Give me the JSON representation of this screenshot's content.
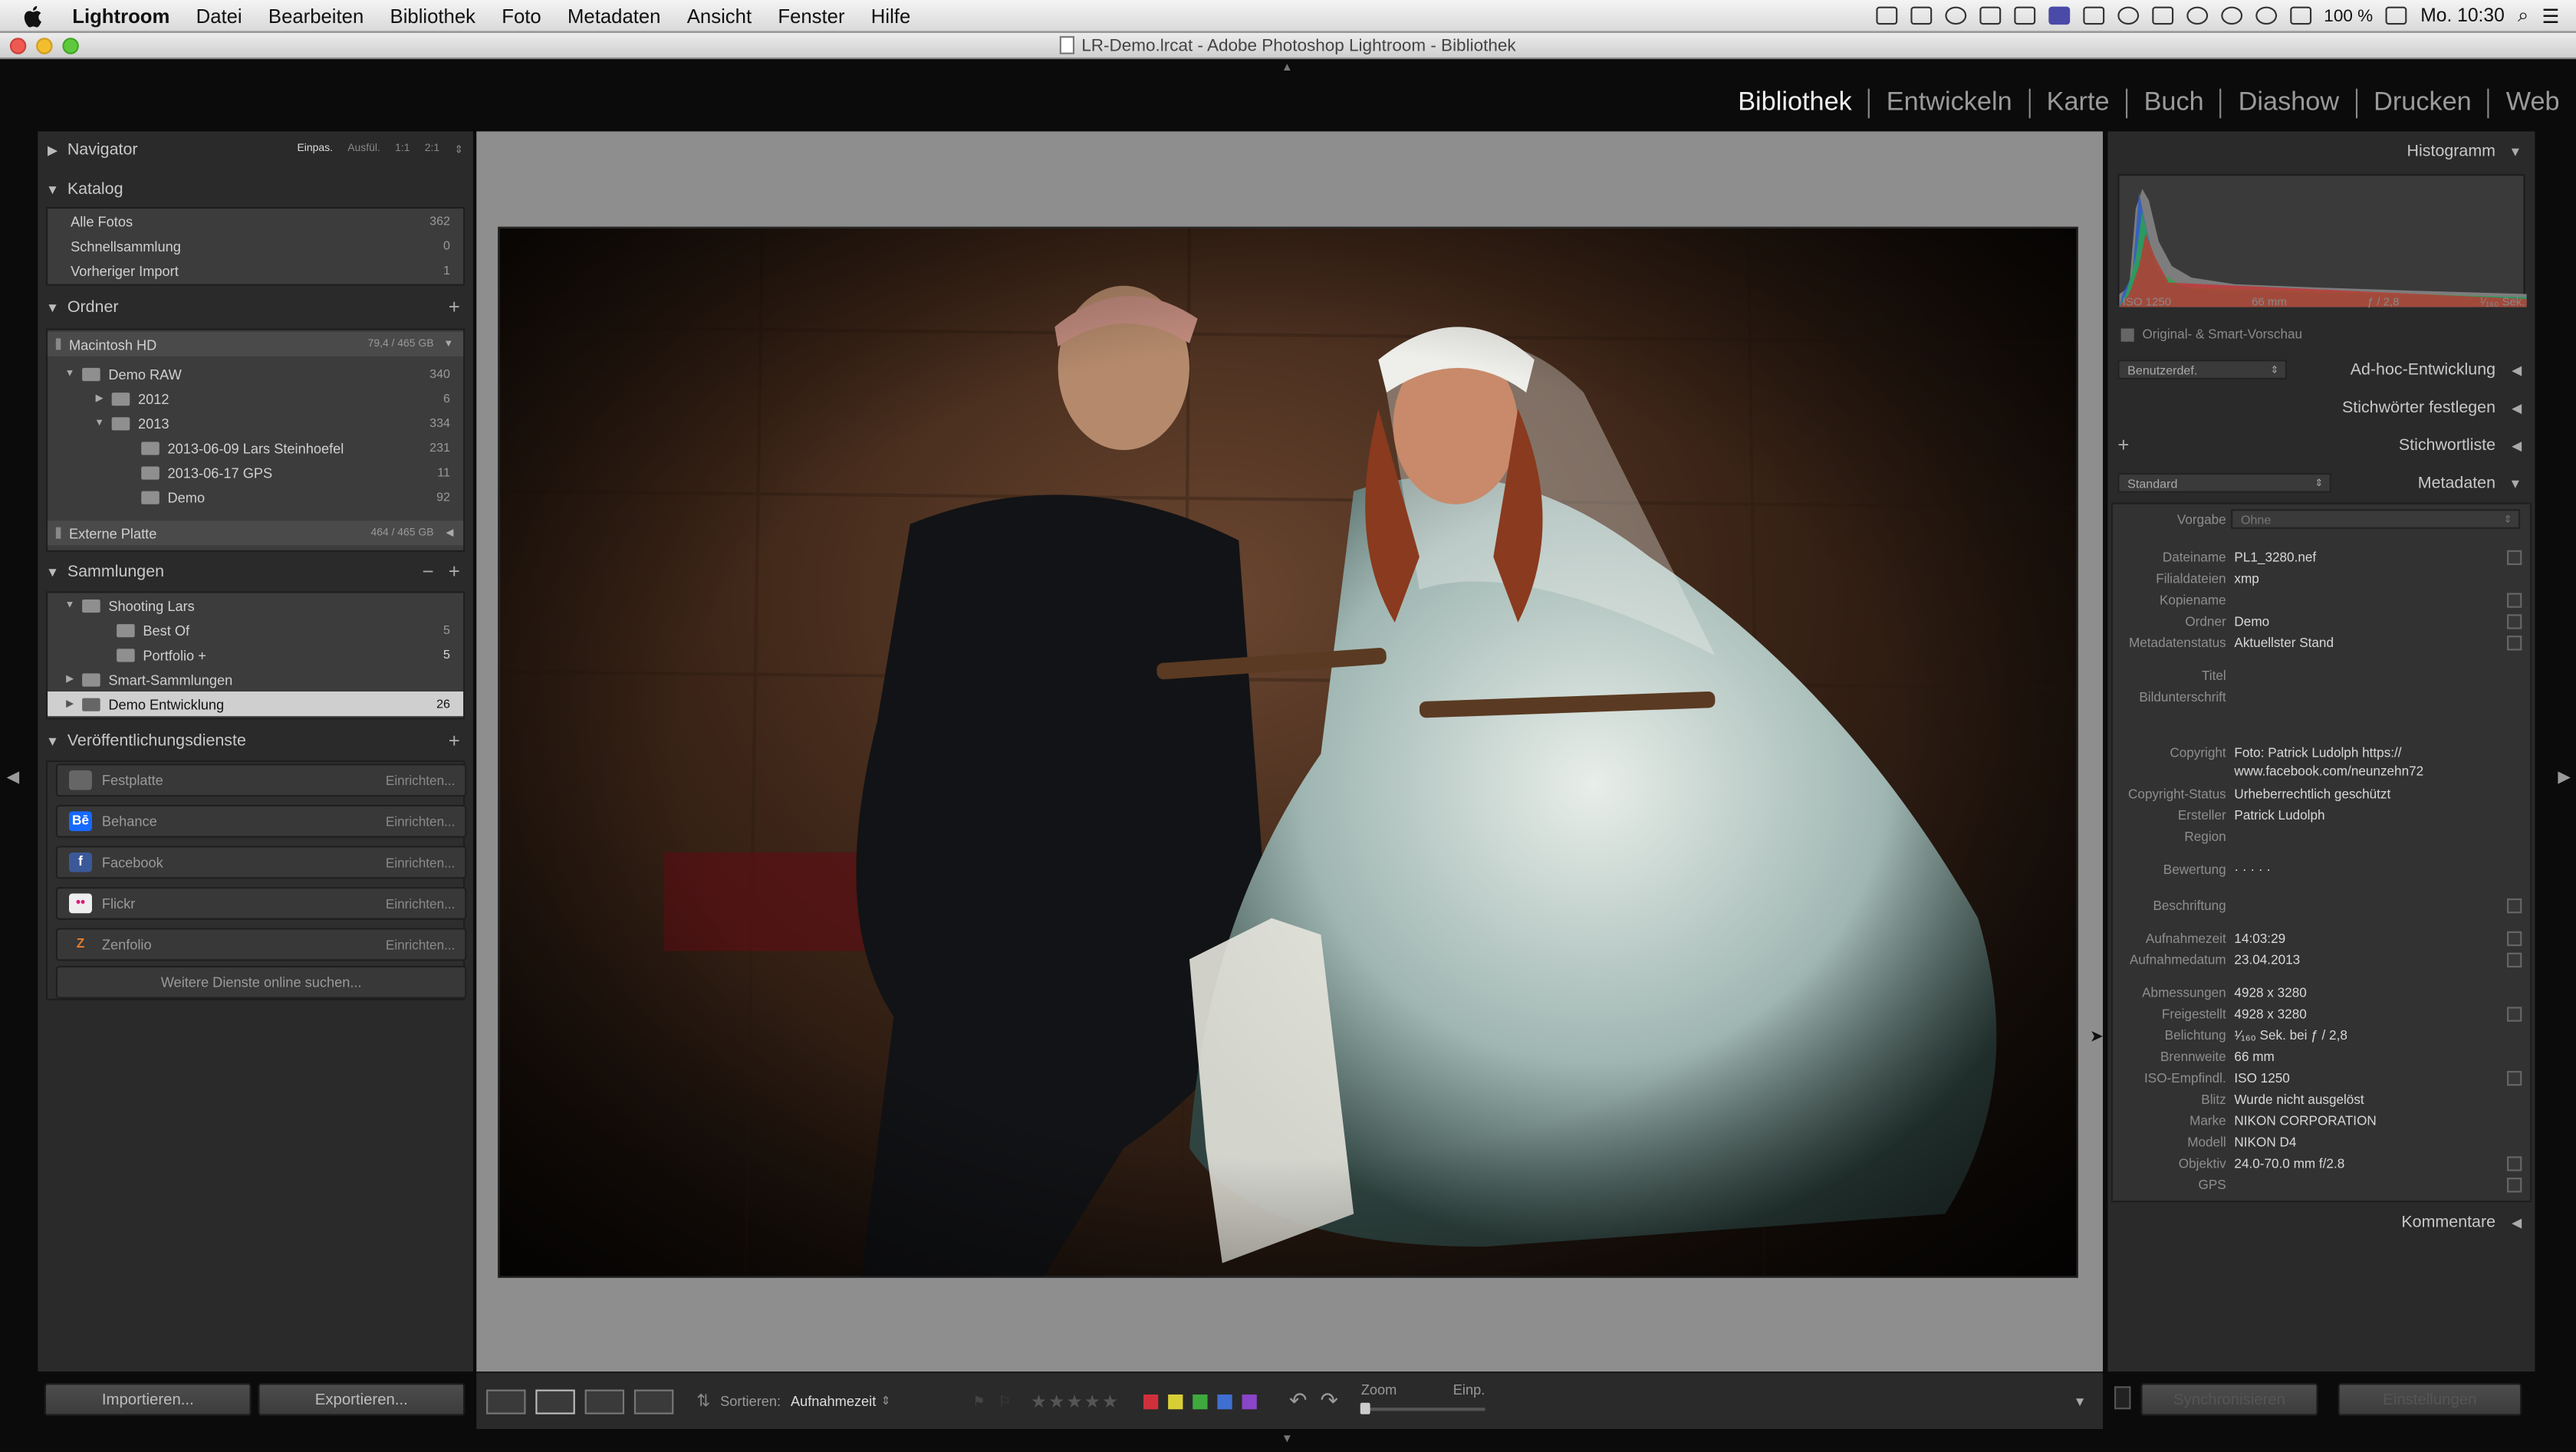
{
  "menubar": {
    "app": "Lightroom",
    "items": [
      "Datei",
      "Bearbeiten",
      "Bibliothek",
      "Foto",
      "Metadaten",
      "Ansicht",
      "Fenster",
      "Hilfe"
    ],
    "battery": "100 %",
    "clock": "Mo. 10:30"
  },
  "window": {
    "title": "LR-Demo.lrcat - Adobe Photoshop Lightroom - Bibliothek"
  },
  "modules": [
    "Bibliothek",
    "Entwickeln",
    "Karte",
    "Buch",
    "Diashow",
    "Drucken",
    "Web"
  ],
  "navigator": {
    "title": "Navigator",
    "zoom_options": [
      "Einpas.",
      "Ausfül.",
      "1:1",
      "2:1"
    ]
  },
  "katalog": {
    "title": "Katalog",
    "items": [
      {
        "label": "Alle Fotos",
        "count": "362"
      },
      {
        "label": "Schnellsammlung",
        "count": "0"
      },
      {
        "label": "Vorheriger Import",
        "count": "1"
      }
    ]
  },
  "ordner": {
    "title": "Ordner",
    "volumes": [
      {
        "label": "Macintosh HD",
        "count": "79,4 / 465 GB"
      },
      {
        "label": "Externe Platte",
        "count": "464 / 465 GB"
      }
    ],
    "folders": [
      {
        "label": "Demo RAW",
        "count": "340"
      },
      {
        "label": "2012",
        "count": "6"
      },
      {
        "label": "2013",
        "count": "334"
      },
      {
        "label": "2013-06-09 Lars Steinhoefel",
        "count": "231"
      },
      {
        "label": "2013-06-17 GPS",
        "count": "11"
      },
      {
        "label": "Demo",
        "count": "92"
      }
    ]
  },
  "sammlungen": {
    "title": "Sammlungen",
    "items": [
      {
        "label": "Shooting Lars",
        "count": ""
      },
      {
        "label": "Best Of",
        "count": "5"
      },
      {
        "label": "Portfolio +",
        "count": "5"
      },
      {
        "label": "Smart-Sammlungen",
        "count": ""
      },
      {
        "label": "Demo Entwicklung",
        "count": "26"
      }
    ]
  },
  "publish": {
    "title": "Veröffentlichungsdienste",
    "services": [
      {
        "label": "Festplatte",
        "action": "Einrichten...",
        "icon": "hard-drive-icon"
      },
      {
        "label": "Behance",
        "action": "Einrichten...",
        "icon": "behance-icon",
        "glyph": "Bē"
      },
      {
        "label": "Facebook",
        "action": "Einrichten...",
        "icon": "facebook-icon",
        "glyph": "f"
      },
      {
        "label": "Flickr",
        "action": "Einrichten...",
        "icon": "flickr-icon",
        "glyph": "••"
      },
      {
        "label": "Zenfolio",
        "action": "Einrichten...",
        "icon": "zenfolio-icon",
        "glyph": "Z"
      }
    ],
    "more": "Weitere Dienste online suchen..."
  },
  "left_buttons": {
    "import": "Importieren...",
    "export": "Exportieren..."
  },
  "toolbar": {
    "sort_label": "Sortieren:",
    "sort_value": "Aufnahmezeit",
    "zoom_label": "Zoom",
    "zoom_value": "Einp.",
    "stars": "★★★★★",
    "color_labels": [
      "#d0303c",
      "#d8cf35",
      "#3eaa3e",
      "#3f6fd0",
      "#8a45c8"
    ]
  },
  "histogram": {
    "title": "Histogramm",
    "iso": "ISO 1250",
    "focal": "66 mm",
    "aperture": "ƒ / 2,8",
    "shutter": "¹⁄₁₆₀ Sek.",
    "preview": "Original- & Smart-Vorschau"
  },
  "right_headers": {
    "quick_develop_preset": "Benutzerdef.",
    "quick_develop": "Ad-hoc-Entwicklung",
    "keywording": "Stichwörter festlegen",
    "keyword_list": "Stichwortliste",
    "metadata_preset": "Standard",
    "metadata": "Metadaten",
    "comments": "Kommentare"
  },
  "metadata": {
    "preset_label": "Vorgabe",
    "preset_value": "Ohne",
    "fields": [
      {
        "label": "Dateiname",
        "value": "PL1_3280.nef"
      },
      {
        "label": "Filialdateien",
        "value": "xmp"
      },
      {
        "label": "Kopiename",
        "value": ""
      },
      {
        "label": "Ordner",
        "value": "Demo"
      },
      {
        "label": "Metadatenstatus",
        "value": "Aktuellster Stand"
      },
      {
        "label": "Titel",
        "value": ""
      },
      {
        "label": "Bildunterschrift",
        "value": ""
      },
      {
        "label": "Copyright",
        "value": "Foto: Patrick Ludolph https://"
      },
      {
        "label": "",
        "value": "www.facebook.com/neunzehn72"
      },
      {
        "label": "Copyright-Status",
        "value": "Urheberrechtlich geschützt"
      },
      {
        "label": "Ersteller",
        "value": "Patrick Ludolph"
      },
      {
        "label": "Region",
        "value": ""
      },
      {
        "label": "Bewertung",
        "value": "· · · · ·"
      },
      {
        "label": "Beschriftung",
        "value": ""
      },
      {
        "label": "Aufnahmezeit",
        "value": "14:03:29"
      },
      {
        "label": "Aufnahmedatum",
        "value": "23.04.2013"
      },
      {
        "label": "Abmessungen",
        "value": "4928 x 3280"
      },
      {
        "label": "Freigestellt",
        "value": "4928 x 3280"
      },
      {
        "label": "Belichtung",
        "value": "¹⁄₁₆₀ Sek. bei ƒ / 2,8"
      },
      {
        "label": "Brennweite",
        "value": "66 mm"
      },
      {
        "label": "ISO-Empfindl.",
        "value": "ISO 1250"
      },
      {
        "label": "Blitz",
        "value": "Wurde nicht ausgelöst"
      },
      {
        "label": "Marke",
        "value": "NIKON CORPORATION"
      },
      {
        "label": "Modell",
        "value": "NIKON D4"
      },
      {
        "label": "Objektiv",
        "value": "24.0-70.0 mm f/2.8"
      },
      {
        "label": "GPS",
        "value": ""
      }
    ]
  },
  "right_buttons": {
    "sync": "Synchronisieren",
    "sync_settings": "Einstellungen"
  }
}
